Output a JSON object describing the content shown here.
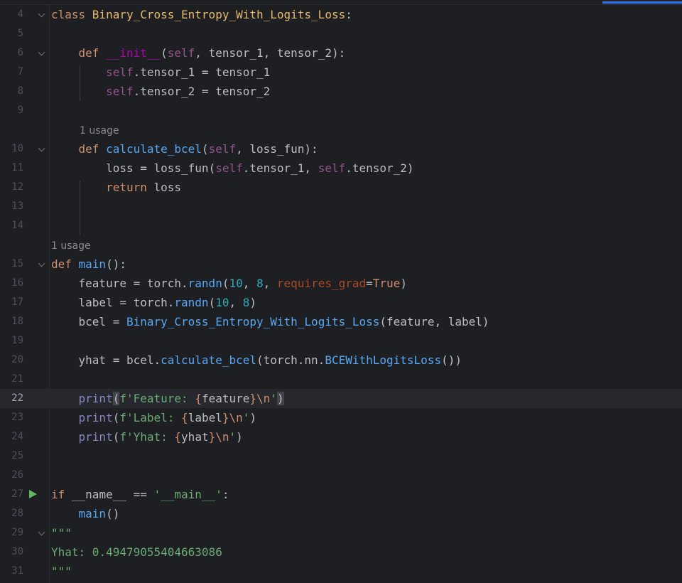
{
  "lines": [
    {
      "n": "4",
      "tokens": [
        [
          "kw",
          "class "
        ],
        [
          "cls",
          "Binary_Cross_Entropy_With_Logits_Loss"
        ],
        [
          "",
          ":"
        ]
      ],
      "fold": true
    },
    {
      "n": "5",
      "tokens": []
    },
    {
      "n": "6",
      "tokens": [
        [
          "",
          "    "
        ],
        [
          "kw",
          "def "
        ],
        [
          "magic",
          "__init__"
        ],
        [
          "",
          "("
        ],
        [
          "self",
          "self"
        ],
        [
          "",
          ", "
        ],
        [
          "param",
          "tensor_1"
        ],
        [
          "",
          ", "
        ],
        [
          "param",
          "tensor_2"
        ],
        [
          "",
          "):"
        ]
      ],
      "fold": true
    },
    {
      "n": "7",
      "tokens": [
        [
          "",
          "        "
        ],
        [
          "self",
          "self"
        ],
        [
          "",
          ".tensor_1 = "
        ],
        [
          "param",
          "tensor_1"
        ]
      ]
    },
    {
      "n": "8",
      "tokens": [
        [
          "",
          "        "
        ],
        [
          "self",
          "self"
        ],
        [
          "",
          ".tensor_2 = "
        ],
        [
          "param",
          "tensor_2"
        ]
      ]
    },
    {
      "n": "9",
      "tokens": []
    },
    {
      "n": "",
      "hint": "1 usage",
      "indent": 1
    },
    {
      "n": "10",
      "tokens": [
        [
          "",
          "    "
        ],
        [
          "kw",
          "def "
        ],
        [
          "fn",
          "calculate_bcel"
        ],
        [
          "",
          "("
        ],
        [
          "self",
          "self"
        ],
        [
          "",
          ", "
        ],
        [
          "param",
          "loss_fun"
        ],
        [
          "",
          "):"
        ]
      ],
      "fold": true
    },
    {
      "n": "11",
      "tokens": [
        [
          "",
          "        loss = "
        ],
        [
          "param",
          "loss_fun"
        ],
        [
          "",
          "("
        ],
        [
          "self",
          "self"
        ],
        [
          "",
          ".tensor_1, "
        ],
        [
          "self",
          "self"
        ],
        [
          "",
          ".tensor_2)"
        ]
      ]
    },
    {
      "n": "12",
      "tokens": [
        [
          "",
          "        "
        ],
        [
          "kw",
          "return "
        ],
        [
          "",
          "loss"
        ]
      ]
    },
    {
      "n": "13",
      "tokens": []
    },
    {
      "n": "14",
      "tokens": []
    },
    {
      "n": "",
      "hint": "1 usage",
      "indent": 0
    },
    {
      "n": "15",
      "tokens": [
        [
          "kw",
          "def "
        ],
        [
          "fn",
          "main"
        ],
        [
          "",
          "():"
        ]
      ],
      "fold": true
    },
    {
      "n": "16",
      "tokens": [
        [
          "",
          "    feature = torch."
        ],
        [
          "fn",
          "randn"
        ],
        [
          "",
          "("
        ],
        [
          "num",
          "10"
        ],
        [
          "",
          ", "
        ],
        [
          "num",
          "8"
        ],
        [
          "",
          ", "
        ],
        [
          "kwarg",
          "requires_grad"
        ],
        [
          "",
          "="
        ],
        [
          "kw",
          "True"
        ],
        [
          "",
          ")"
        ]
      ]
    },
    {
      "n": "17",
      "tokens": [
        [
          "",
          "    label = torch."
        ],
        [
          "fn",
          "randn"
        ],
        [
          "",
          "("
        ],
        [
          "num",
          "10"
        ],
        [
          "",
          ", "
        ],
        [
          "num",
          "8"
        ],
        [
          "",
          ")"
        ]
      ]
    },
    {
      "n": "18",
      "tokens": [
        [
          "",
          "    bcel = "
        ],
        [
          "fn",
          "Binary_Cross_Entropy_With_Logits_Loss"
        ],
        [
          "",
          "(feature, label)"
        ]
      ]
    },
    {
      "n": "19",
      "tokens": []
    },
    {
      "n": "20",
      "tokens": [
        [
          "",
          "    yhat = bcel."
        ],
        [
          "fn",
          "calculate_bcel"
        ],
        [
          "",
          "(torch.nn."
        ],
        [
          "fn",
          "BCEWithLogitsLoss"
        ],
        [
          "",
          "())"
        ]
      ]
    },
    {
      "n": "21",
      "tokens": []
    },
    {
      "n": "22",
      "current": true,
      "tokens": [
        [
          "",
          "    "
        ],
        [
          "builtin",
          "print"
        ],
        [
          "bracket-hl",
          "("
        ],
        [
          "str",
          "f'Feature: "
        ],
        [
          "brace",
          "{"
        ],
        [
          "",
          "feature"
        ],
        [
          "brace",
          "}"
        ],
        [
          "esc",
          "\\n"
        ],
        [
          "str",
          "'"
        ],
        [
          "bracket-hl",
          ")"
        ]
      ]
    },
    {
      "n": "23",
      "tokens": [
        [
          "",
          "    "
        ],
        [
          "builtin",
          "print"
        ],
        [
          "",
          "("
        ],
        [
          "str",
          "f'Label: "
        ],
        [
          "brace",
          "{"
        ],
        [
          "",
          "label"
        ],
        [
          "brace",
          "}"
        ],
        [
          "esc",
          "\\n"
        ],
        [
          "str",
          "'"
        ],
        [
          "",
          ")"
        ]
      ]
    },
    {
      "n": "24",
      "tokens": [
        [
          "",
          "    "
        ],
        [
          "builtin",
          "print"
        ],
        [
          "",
          "("
        ],
        [
          "str",
          "f'Yhat: "
        ],
        [
          "brace",
          "{"
        ],
        [
          "",
          "yhat"
        ],
        [
          "brace",
          "}"
        ],
        [
          "esc",
          "\\n"
        ],
        [
          "str",
          "'"
        ],
        [
          "",
          ")"
        ]
      ]
    },
    {
      "n": "25",
      "tokens": []
    },
    {
      "n": "26",
      "tokens": []
    },
    {
      "n": "27",
      "run": true,
      "tokens": [
        [
          "kw",
          "if "
        ],
        [
          "",
          "__name__ == "
        ],
        [
          "str",
          "'__main__'"
        ],
        [
          "",
          ":"
        ]
      ]
    },
    {
      "n": "28",
      "tokens": [
        [
          "",
          "    "
        ],
        [
          "fn",
          "main"
        ],
        [
          "",
          "()"
        ]
      ]
    },
    {
      "n": "29",
      "fold": true,
      "tokens": [
        [
          "str",
          "\"\"\""
        ]
      ]
    },
    {
      "n": "30",
      "tokens": [
        [
          "str",
          "Yhat: 0.49479055404663086"
        ]
      ]
    },
    {
      "n": "31",
      "tokens": [
        [
          "str",
          "\"\"\""
        ]
      ]
    }
  ],
  "icons": {
    "fold": "chevron-down-icon",
    "run": "play-icon"
  }
}
